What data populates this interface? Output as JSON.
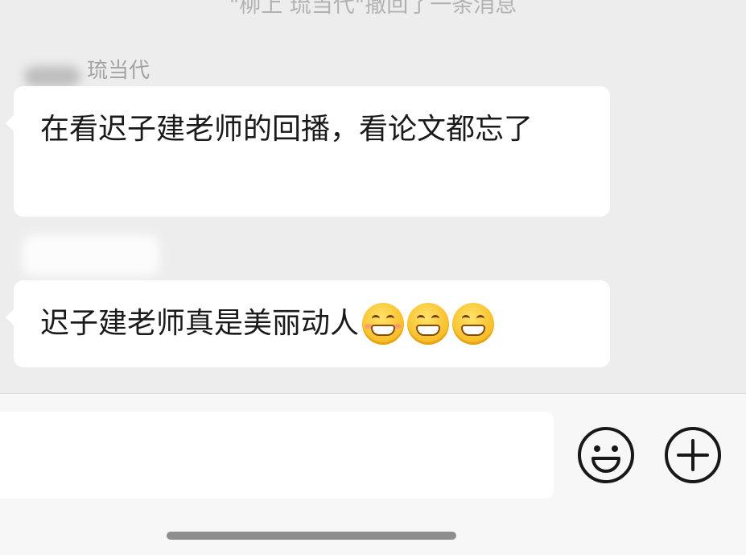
{
  "system_notice": "\"柳上 琉当代\"撤回了一条消息",
  "messages": [
    {
      "sender": "琉当代",
      "text": "在看迟子建老师的回播，看论文都忘了"
    },
    {
      "sender": "",
      "text": "迟子建老师真是美丽动人",
      "emojis": [
        "grin-blush-emoji",
        "grin-emoji",
        "grin-emoji"
      ]
    }
  ],
  "input_bar": {
    "message_value": "",
    "icons": [
      "emoji-smile-icon",
      "plus-circle-icon"
    ]
  }
}
